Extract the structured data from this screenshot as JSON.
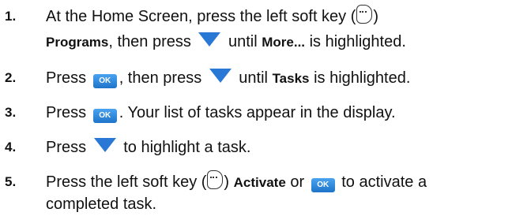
{
  "steps": [
    {
      "number": "1.",
      "line1": {
        "a": "At the Home Screen, press the left soft key (",
        "b": ")"
      },
      "line2": {
        "bold1": "Programs",
        "a": ", then press ",
        "b": " until ",
        "bold2": "More...",
        "c": " is highlighted."
      }
    },
    {
      "number": "2.",
      "a": "Press ",
      "b": ", then press ",
      "c": " until ",
      "bold": "Tasks",
      "d": " is highlighted."
    },
    {
      "number": "3.",
      "a": "Press ",
      "b": ". Your list of tasks appear in the display."
    },
    {
      "number": "4.",
      "a": "Press ",
      "b": " to highlight a task."
    },
    {
      "number": "5.",
      "line1": {
        "a": "Press the left soft key (",
        "b": ") ",
        "bold": "Activate",
        "c": " or ",
        "d": " to activate a"
      },
      "line2": "completed task."
    }
  ],
  "icons": {
    "soft_key": "left-soft-key-icon",
    "down_arrow": "down-arrow-icon",
    "ok_key": "ok-key-icon"
  },
  "ok_label": "OK",
  "colors": {
    "arrow": "#2a78d6",
    "ok_key": "#2a84db"
  }
}
